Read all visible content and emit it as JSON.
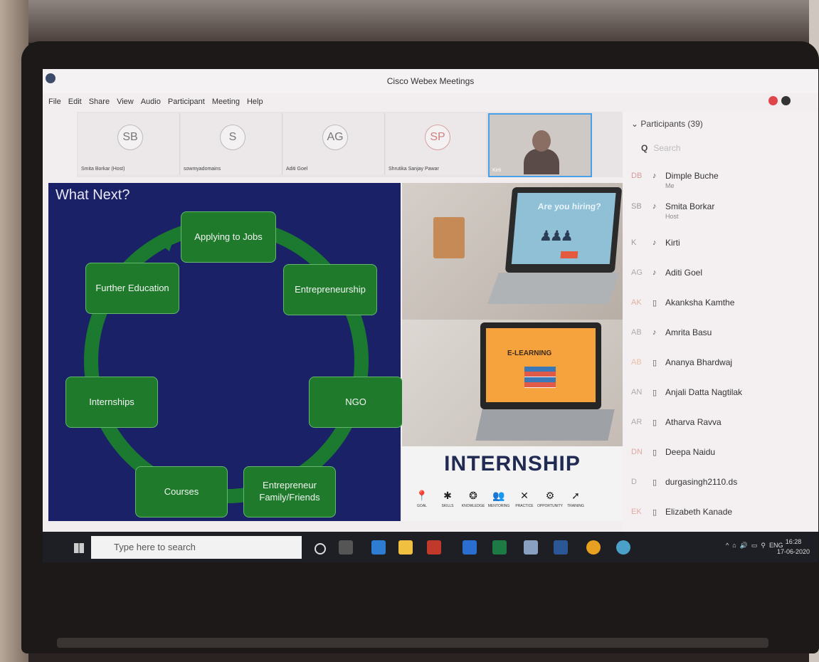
{
  "window": {
    "title": "Cisco Webex Meetings"
  },
  "menu": [
    "File",
    "Edit",
    "Share",
    "View",
    "Audio",
    "Participant",
    "Meeting",
    "Help"
  ],
  "filmstrip": [
    {
      "initials": "SB",
      "name": "Smita Borkar (Host)"
    },
    {
      "initials": "S",
      "name": "sowmyadomains"
    },
    {
      "initials": "AG",
      "name": "Aditi Goel"
    },
    {
      "initials": "SP",
      "name": "Shrutika Sanjay Pawar"
    },
    {
      "initials": "",
      "name": "Kirti"
    }
  ],
  "slide": {
    "title": "What Next?",
    "steps": [
      "Applying to Jobs",
      "Entrepreneurship",
      "NGO",
      "Entrepreneur Family/Friends",
      "Courses",
      "Internships",
      "Further Education"
    ]
  },
  "photo": {
    "hiring": "Are you hiring?",
    "elearning": "E-LEARNING",
    "internship": "INTERNSHIP",
    "icons": [
      {
        "glyph": "📍",
        "label": "GOAL"
      },
      {
        "glyph": "✱",
        "label": "SKILLS"
      },
      {
        "glyph": "❂",
        "label": "KNOWLEDGE"
      },
      {
        "glyph": "👥",
        "label": "MENTORING"
      },
      {
        "glyph": "✕",
        "label": "PRACTICE"
      },
      {
        "glyph": "⚙",
        "label": "OPPORTUNITY"
      },
      {
        "glyph": "➚",
        "label": "TRAINING"
      }
    ]
  },
  "participants": {
    "header": "Participants (39)",
    "search_placeholder": "Search",
    "list": [
      {
        "initials": "DB",
        "name": "Dimple Buche",
        "sub": "Me"
      },
      {
        "initials": "SB",
        "name": "Smita Borkar",
        "sub": "Host"
      },
      {
        "initials": "K",
        "name": "Kirti",
        "sub": ""
      },
      {
        "initials": "AG",
        "name": "Aditi Goel",
        "sub": ""
      },
      {
        "initials": "AK",
        "name": "Akanksha Kamthe",
        "sub": ""
      },
      {
        "initials": "AB",
        "name": "Amrita Basu",
        "sub": ""
      },
      {
        "initials": "AB",
        "name": "Ananya Bhardwaj",
        "sub": ""
      },
      {
        "initials": "AN",
        "name": "Anjali Datta Nagtilak",
        "sub": ""
      },
      {
        "initials": "AR",
        "name": "Atharva Ravva",
        "sub": ""
      },
      {
        "initials": "DN",
        "name": "Deepa Naidu",
        "sub": ""
      },
      {
        "initials": "D",
        "name": "durgasingh2110.ds",
        "sub": ""
      },
      {
        "initials": "EK",
        "name": "Elizabeth Kanade",
        "sub": ""
      }
    ]
  },
  "taskbar": {
    "search_placeholder": "Type here to search",
    "lang": "ENG",
    "time": "16:28",
    "date": "17-06-2020"
  }
}
